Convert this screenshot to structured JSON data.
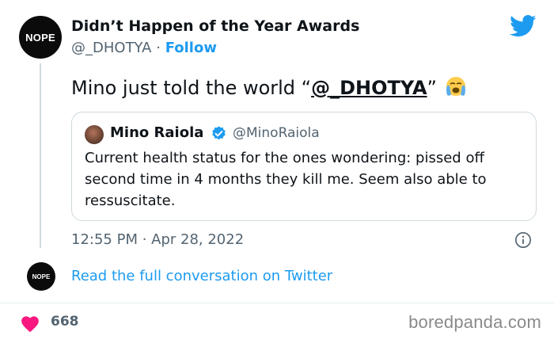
{
  "author": {
    "avatar_text": "NOPE",
    "name": "Didn’t Happen of the Year Awards",
    "handle": "@_DHOTYA",
    "separator": "·",
    "follow_label": "Follow"
  },
  "tweet": {
    "text_before": "Mino just told the world “",
    "mention": "@_DHOTYA",
    "text_after": "”",
    "emoji": "loudly-crying-face-emoji"
  },
  "quote": {
    "name": "Mino Raiola",
    "handle": "@MinoRaiola",
    "text": "Current health status for the ones wondering: pissed off second time in 4 months they kill me. Seem also able to ressuscitate."
  },
  "meta": {
    "timestamp": "12:55 PM · Apr 28, 2022"
  },
  "footer": {
    "avatar_text": "NOPE",
    "read_link": "Read the full conversation on Twitter",
    "likes": "668",
    "watermark": "boredpanda.com"
  },
  "colors": {
    "accent": "#1d9bf0",
    "heart": "#f91880",
    "muted": "#536471"
  },
  "icons": [
    "twitter-bird-icon",
    "verified-badge-icon",
    "info-icon",
    "heart-icon"
  ]
}
